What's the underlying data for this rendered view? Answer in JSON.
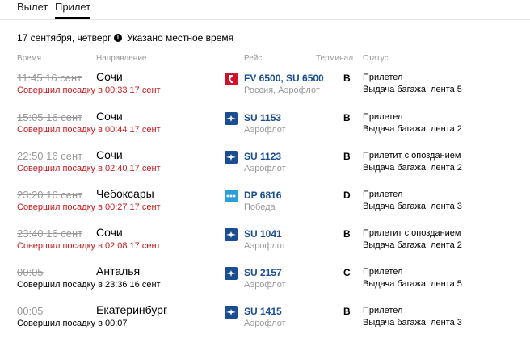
{
  "tabs": {
    "departure": "Вылет",
    "arrival": "Прилет"
  },
  "date_line": "17 сентября, четверг",
  "tz_note": "Указано местное время",
  "headers": {
    "time": "Время",
    "direction": "Направление",
    "flight": "Рейс",
    "terminal": "Терминал",
    "status": "Статус"
  },
  "colors": {
    "late": "#c8191e",
    "link": "#1a4e90",
    "muted": "#999999"
  },
  "rows": [
    {
      "scheduled": "11:45 16 сент",
      "landed": "Совершил посадку в 00:33 17 сент",
      "late": true,
      "city": "Сочи",
      "logo": "red-wings-logo",
      "flight": "FV 6500, SU 6500",
      "airline": "Россия, Аэрофлот",
      "terminal": "B",
      "status": "Прилетел",
      "baggage": "Выдача багажа: лента 5"
    },
    {
      "scheduled": "15:05 16 сент",
      "landed": "Совершил посадку в 00:44 17 сент",
      "late": true,
      "city": "Сочи",
      "logo": "aeroflot-logo",
      "flight": "SU 1153",
      "airline": "Аэрофлот",
      "terminal": "B",
      "status": "Прилетел",
      "baggage": "Выдача багажа: лента 2"
    },
    {
      "scheduled": "22:50 16 сент",
      "landed": "Совершил посадку в 02:40 17 сент",
      "late": true,
      "city": "Сочи",
      "logo": "aeroflot-logo",
      "flight": "SU 1123",
      "airline": "Аэрофлот",
      "terminal": "B",
      "status": "Прилетит с опозданием",
      "baggage": "Выдача багажа: лента 2"
    },
    {
      "scheduled": "23:20 16 сент",
      "landed": "Совершил посадку в 00:27 17 сент",
      "late": true,
      "city": "Чебоксары",
      "logo": "pobeda-logo",
      "flight": "DP 6816",
      "airline": "Победа",
      "terminal": "D",
      "status": "Прилетел",
      "baggage": "Выдача багажа: лента 3"
    },
    {
      "scheduled": "23:40 16 сент",
      "landed": "Совершил посадку в 02:08 17 сент",
      "late": true,
      "city": "Сочи",
      "logo": "aeroflot-logo",
      "flight": "SU 1041",
      "airline": "Аэрофлот",
      "terminal": "B",
      "status": "Прилетит с опозданием",
      "baggage": "Выдача багажа: лента 2"
    },
    {
      "scheduled": "00:05",
      "landed": "Совершил посадку в 23:36 16 сент",
      "late": false,
      "city": "Анталья",
      "logo": "aeroflot-logo",
      "flight": "SU 2157",
      "airline": "Аэрофлот",
      "terminal": "C",
      "status": "Прилетел",
      "baggage": "Выдача багажа: лента 5"
    },
    {
      "scheduled": "00:05",
      "landed": "Совершил посадку в 00:07",
      "late": false,
      "city": "Екатеринбург",
      "logo": "aeroflot-logo",
      "flight": "SU 1415",
      "airline": "Аэрофлот",
      "terminal": "B",
      "status": "Прилетел",
      "baggage": "Выдача багажа: лента 3"
    }
  ]
}
